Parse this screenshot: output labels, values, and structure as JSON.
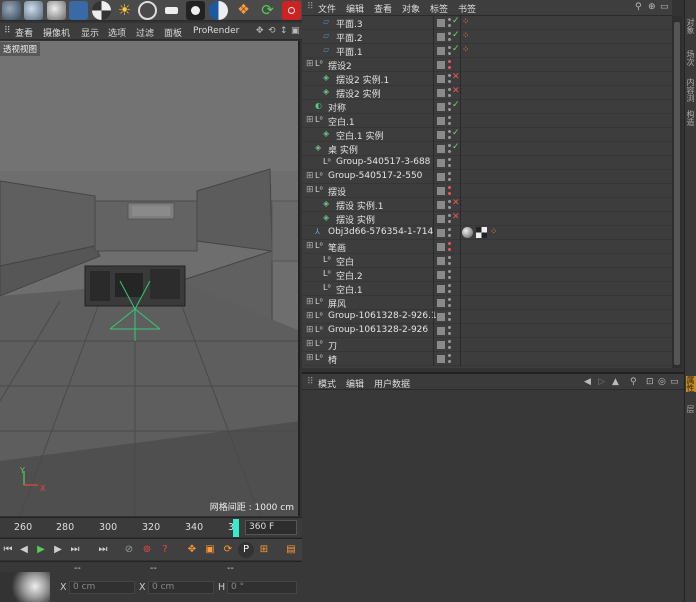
{
  "viewport": {
    "menu": [
      "查看",
      "摄像机",
      "显示",
      "选项",
      "过滤",
      "面板",
      "ProRender"
    ],
    "label": "透视视图",
    "grid_readout": "网格间距 : 1000 cm"
  },
  "timeline": {
    "ticks": [
      "260",
      "280",
      "300",
      "320",
      "340",
      "3"
    ],
    "frame": "360 F"
  },
  "attr_strip": {
    "dash1": "--",
    "dash2": "--",
    "dash3": "--",
    "x_label": "X",
    "x_value": "0 cm",
    "x2_label": "X",
    "x2_value": "0 cm",
    "h_label": "H",
    "h_value": "0 °"
  },
  "object_manager": {
    "menu": [
      "文件",
      "编辑",
      "查看",
      "对象",
      "标签",
      "书签"
    ],
    "rows": [
      {
        "name": "平面.3",
        "indent": 1,
        "icon": "plane-icon",
        "status": "check",
        "tag": "texture"
      },
      {
        "name": "平面.2",
        "indent": 1,
        "icon": "plane-icon",
        "status": "check",
        "tag": "texture"
      },
      {
        "name": "平面.1",
        "indent": 1,
        "icon": "plane-icon",
        "status": "check",
        "tag": "texture"
      },
      {
        "name": "摆设2",
        "indent": 0,
        "icon": "null-icon",
        "status": "dot",
        "tag": ""
      },
      {
        "name": "摆设2 实例.1",
        "indent": 1,
        "icon": "instance-icon",
        "status": "x",
        "tag": ""
      },
      {
        "name": "摆设2 实例",
        "indent": 1,
        "icon": "instance-icon",
        "status": "x",
        "tag": ""
      },
      {
        "name": "对称",
        "indent": 0,
        "icon": "symmetry-icon",
        "status": "check",
        "tag": ""
      },
      {
        "name": "空白.1",
        "indent": 0,
        "icon": "null-icon",
        "status": "dot",
        "tag": ""
      },
      {
        "name": "空白.1 实例",
        "indent": 1,
        "icon": "instance-icon",
        "status": "check",
        "tag": ""
      },
      {
        "name": "桌 实例",
        "indent": 0,
        "icon": "instance-icon",
        "status": "check",
        "tag": ""
      },
      {
        "name": "Group-540517-3-688",
        "indent": 1,
        "icon": "null-icon",
        "status": "dot",
        "tag": ""
      },
      {
        "name": "Group-540517-2-550",
        "indent": 0,
        "icon": "null-icon",
        "status": "dot",
        "tag": ""
      },
      {
        "name": "摆设",
        "indent": 0,
        "icon": "null-icon",
        "status": "dot",
        "tag": ""
      },
      {
        "name": "摆设 实例.1",
        "indent": 1,
        "icon": "instance-icon",
        "status": "x",
        "tag": ""
      },
      {
        "name": "摆设 实例",
        "indent": 1,
        "icon": "instance-icon",
        "status": "x",
        "tag": ""
      },
      {
        "name": "Obj3d66-576354-1-714",
        "indent": 0,
        "icon": "poly-icon",
        "status": "dot",
        "tag": "material"
      },
      {
        "name": "笔画",
        "indent": 0,
        "icon": "null-icon",
        "status": "dot",
        "tag": ""
      },
      {
        "name": "空白",
        "indent": 1,
        "icon": "null-icon",
        "status": "dot",
        "tag": ""
      },
      {
        "name": "空白.2",
        "indent": 1,
        "icon": "null-icon",
        "status": "dot",
        "tag": ""
      },
      {
        "name": "空白.1",
        "indent": 1,
        "icon": "null-icon",
        "status": "dot",
        "tag": ""
      },
      {
        "name": "屏风",
        "indent": 0,
        "icon": "null-icon",
        "status": "dot",
        "tag": ""
      },
      {
        "name": "Group-1061328-2-926.1",
        "indent": 0,
        "icon": "null-icon",
        "status": "dot",
        "tag": ""
      },
      {
        "name": "Group-1061328-2-926",
        "indent": 0,
        "icon": "null-icon",
        "status": "dot",
        "tag": ""
      },
      {
        "name": "刀",
        "indent": 0,
        "icon": "null-icon",
        "status": "dot",
        "tag": ""
      },
      {
        "name": "椅",
        "indent": 0,
        "icon": "null-icon",
        "status": "dot",
        "tag": ""
      }
    ]
  },
  "attributes": {
    "menu": [
      "模式",
      "编辑",
      "用户数据"
    ]
  },
  "right_tabs": [
    "对象",
    "场次",
    "内容浏览器",
    "构造",
    "属性",
    "层"
  ],
  "colors": {
    "accent_green": "#66dd66",
    "accent_red": "#ee5555",
    "playhead": "#33eecc"
  }
}
